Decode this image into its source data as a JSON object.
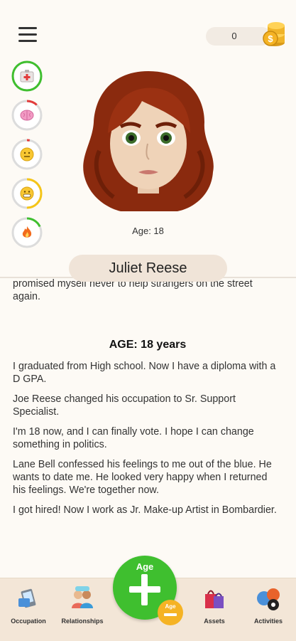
{
  "header": {
    "coins_value": "0"
  },
  "stats": [
    {
      "name": "health",
      "icon": "first-aid-icon",
      "level": 1.0,
      "color": "#3fbf2f"
    },
    {
      "name": "smarts",
      "icon": "brain-icon",
      "level": 0.12,
      "color": "#e23b3b"
    },
    {
      "name": "mood",
      "icon": "face-icon",
      "level": 0.03,
      "color": "#e23b3b"
    },
    {
      "name": "happiness",
      "icon": "grin-icon",
      "level": 0.5,
      "color": "#f5c518"
    },
    {
      "name": "energy",
      "icon": "fire-icon",
      "level": 0.18,
      "color": "#3fbf2f"
    }
  ],
  "profile": {
    "age_caption": "Age: 18",
    "name": "Juliet Reese"
  },
  "feed": {
    "partial_text": "promised myself never to help strangers on the street again.",
    "section_title": "AGE: 18 years",
    "entries": [
      "I graduated from High school.  Now I have a diploma with a D GPA.",
      "Joe Reese changed his occupation to Sr. Support Specialist.",
      "I'm 18 now, and I can finally vote. I hope I can change something in politics.",
      "Lane Bell confessed his feelings to me out of the blue. He wants to date me. He looked very happy when I returned his feelings. We're together now.",
      "I got hired! Now I work as Jr. Make-up Artist in Bombardier."
    ]
  },
  "bottom_nav": {
    "occupation": "Occupation",
    "relationships": "Relationships",
    "age_button": "Age",
    "age_minus": "Age",
    "assets": "Assets",
    "activities": "Activities"
  }
}
